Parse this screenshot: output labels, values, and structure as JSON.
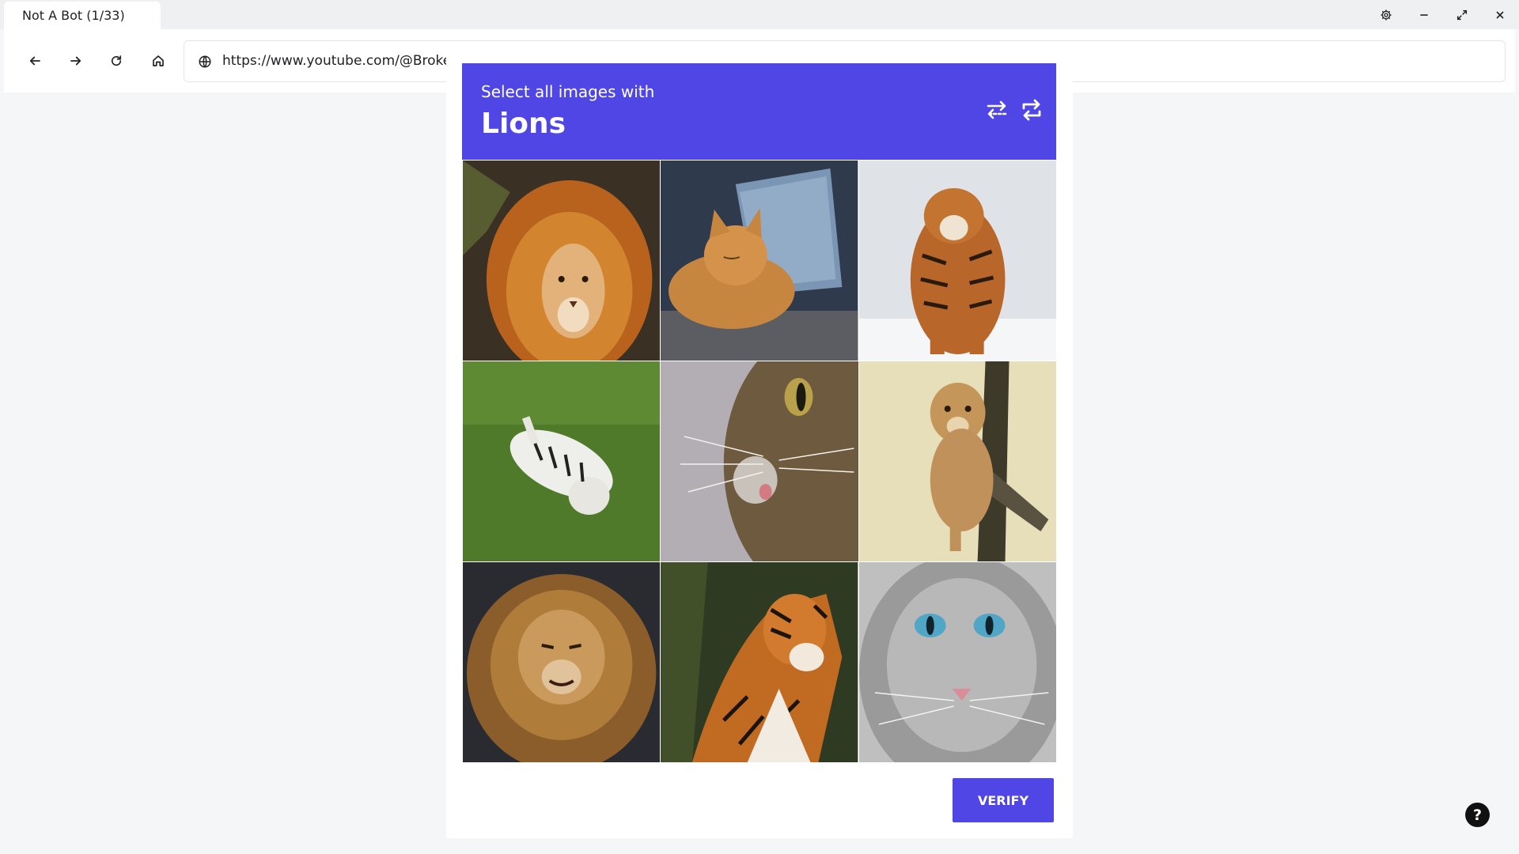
{
  "browser": {
    "tab_title": "Not A Bot (1/33)",
    "url": "https://www.youtube.com/@BrokenBc"
  },
  "captcha": {
    "prompt": "Select all images with",
    "target": "Lions",
    "verify_label": "VERIFY",
    "header_color": "#4f46e5",
    "tiles": [
      {
        "subject": "lion"
      },
      {
        "subject": "cat"
      },
      {
        "subject": "tiger"
      },
      {
        "subject": "tiger"
      },
      {
        "subject": "cat"
      },
      {
        "subject": "lion"
      },
      {
        "subject": "lion"
      },
      {
        "subject": "tiger"
      },
      {
        "subject": "cat"
      }
    ]
  },
  "help": {
    "label": "?"
  },
  "icons": {
    "back": "arrow-left-icon",
    "forward": "arrow-right-icon",
    "reload": "reload-icon",
    "home": "home-icon",
    "site": "globe-icon",
    "settings": "gear-icon",
    "minimize": "minimize-icon",
    "maximize": "expand-icon",
    "close": "close-icon",
    "audio": "swap-arrows-icon",
    "refresh": "refresh-icon"
  }
}
